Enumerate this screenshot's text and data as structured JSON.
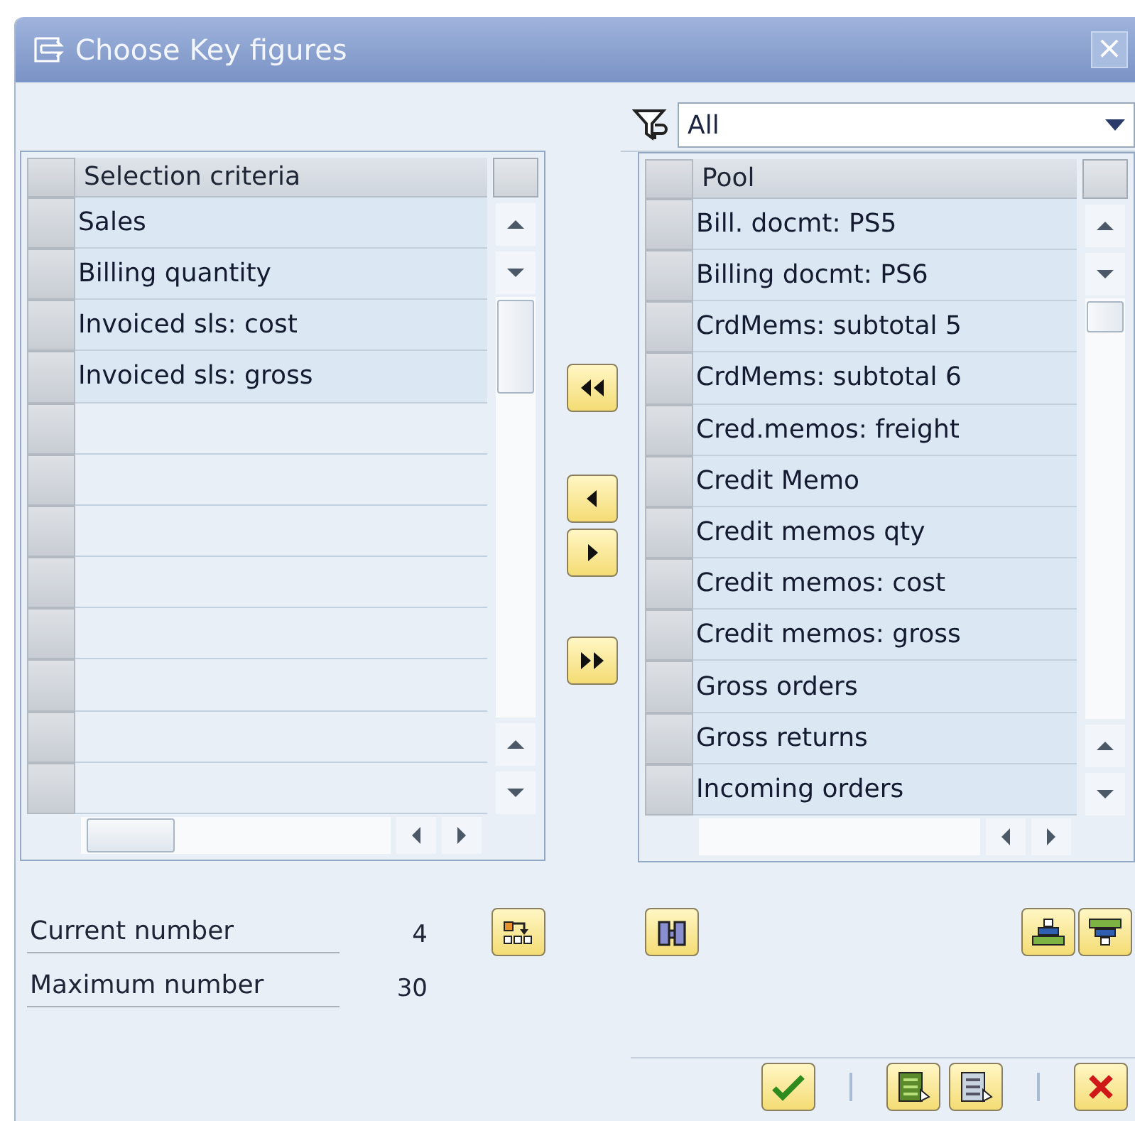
{
  "window": {
    "title": "Choose Key figures",
    "close_glyph": "×"
  },
  "filter": {
    "value": "All"
  },
  "selection_table": {
    "header": "Selection criteria",
    "rows": [
      {
        "text": "Sales"
      },
      {
        "text": "Billing quantity"
      },
      {
        "text": "Invoiced sls: cost"
      },
      {
        "text": "Invoiced sls: gross"
      }
    ]
  },
  "pool_table": {
    "header": "Pool",
    "rows": [
      {
        "text": "Bill. docmt: PS5"
      },
      {
        "text": "Billing docmt: PS6"
      },
      {
        "text": "CrdMems: subtotal 5"
      },
      {
        "text": "CrdMems: subtotal 6"
      },
      {
        "text": "Cred.memos: freight"
      },
      {
        "text": "Credit Memo"
      },
      {
        "text": "Credit memos qty"
      },
      {
        "text": "Credit memos: cost"
      },
      {
        "text": "Credit memos: gross"
      },
      {
        "text": "Gross orders"
      },
      {
        "text": "Gross returns"
      },
      {
        "text": "Incoming orders"
      }
    ]
  },
  "counts": [
    {
      "label": "Current number",
      "value": "4"
    },
    {
      "label": "Maximum number",
      "value": "30"
    }
  ]
}
